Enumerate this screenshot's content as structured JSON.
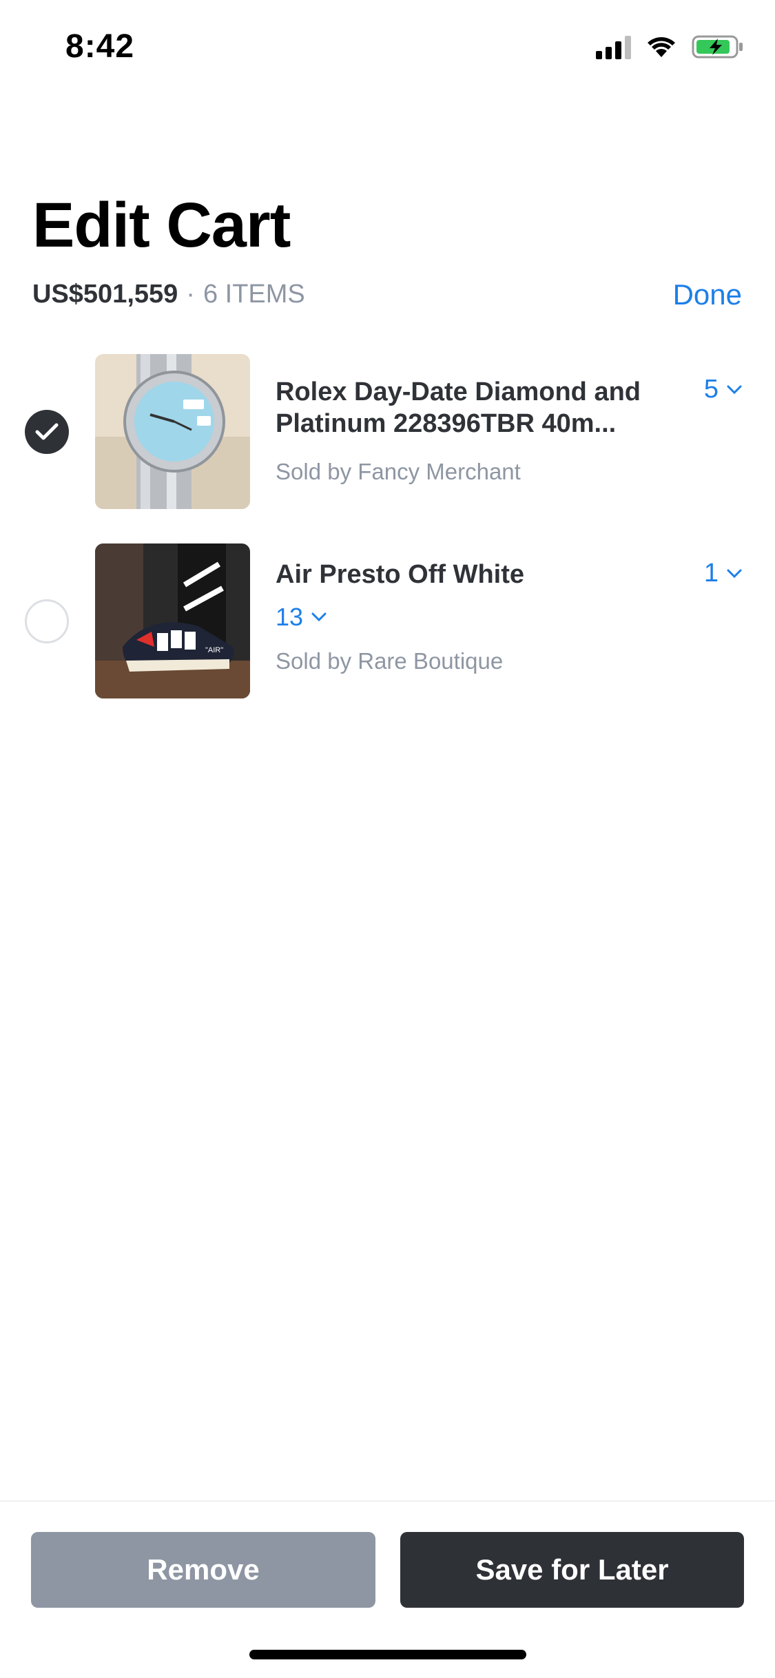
{
  "status_bar": {
    "time": "8:42"
  },
  "header": {
    "title": "Edit Cart",
    "total": "US$501,559",
    "separator": "·",
    "items_count": "6 ITEMS",
    "done_label": "Done"
  },
  "items": [
    {
      "title": "Rolex Day-Date Diamond and Platinum 228396TBR 40m...",
      "seller": "Sold by Fancy Merchant",
      "quantity": "5",
      "selected": true
    },
    {
      "title": "Air Presto Off White",
      "size": "13",
      "seller": "Sold by Rare Boutique",
      "quantity": "1",
      "selected": false
    }
  ],
  "actions": {
    "remove_label": "Remove",
    "save_later_label": "Save for Later"
  },
  "colors": {
    "accent": "#1d7fe8",
    "dark": "#2e3136",
    "muted": "#8e96a3"
  }
}
